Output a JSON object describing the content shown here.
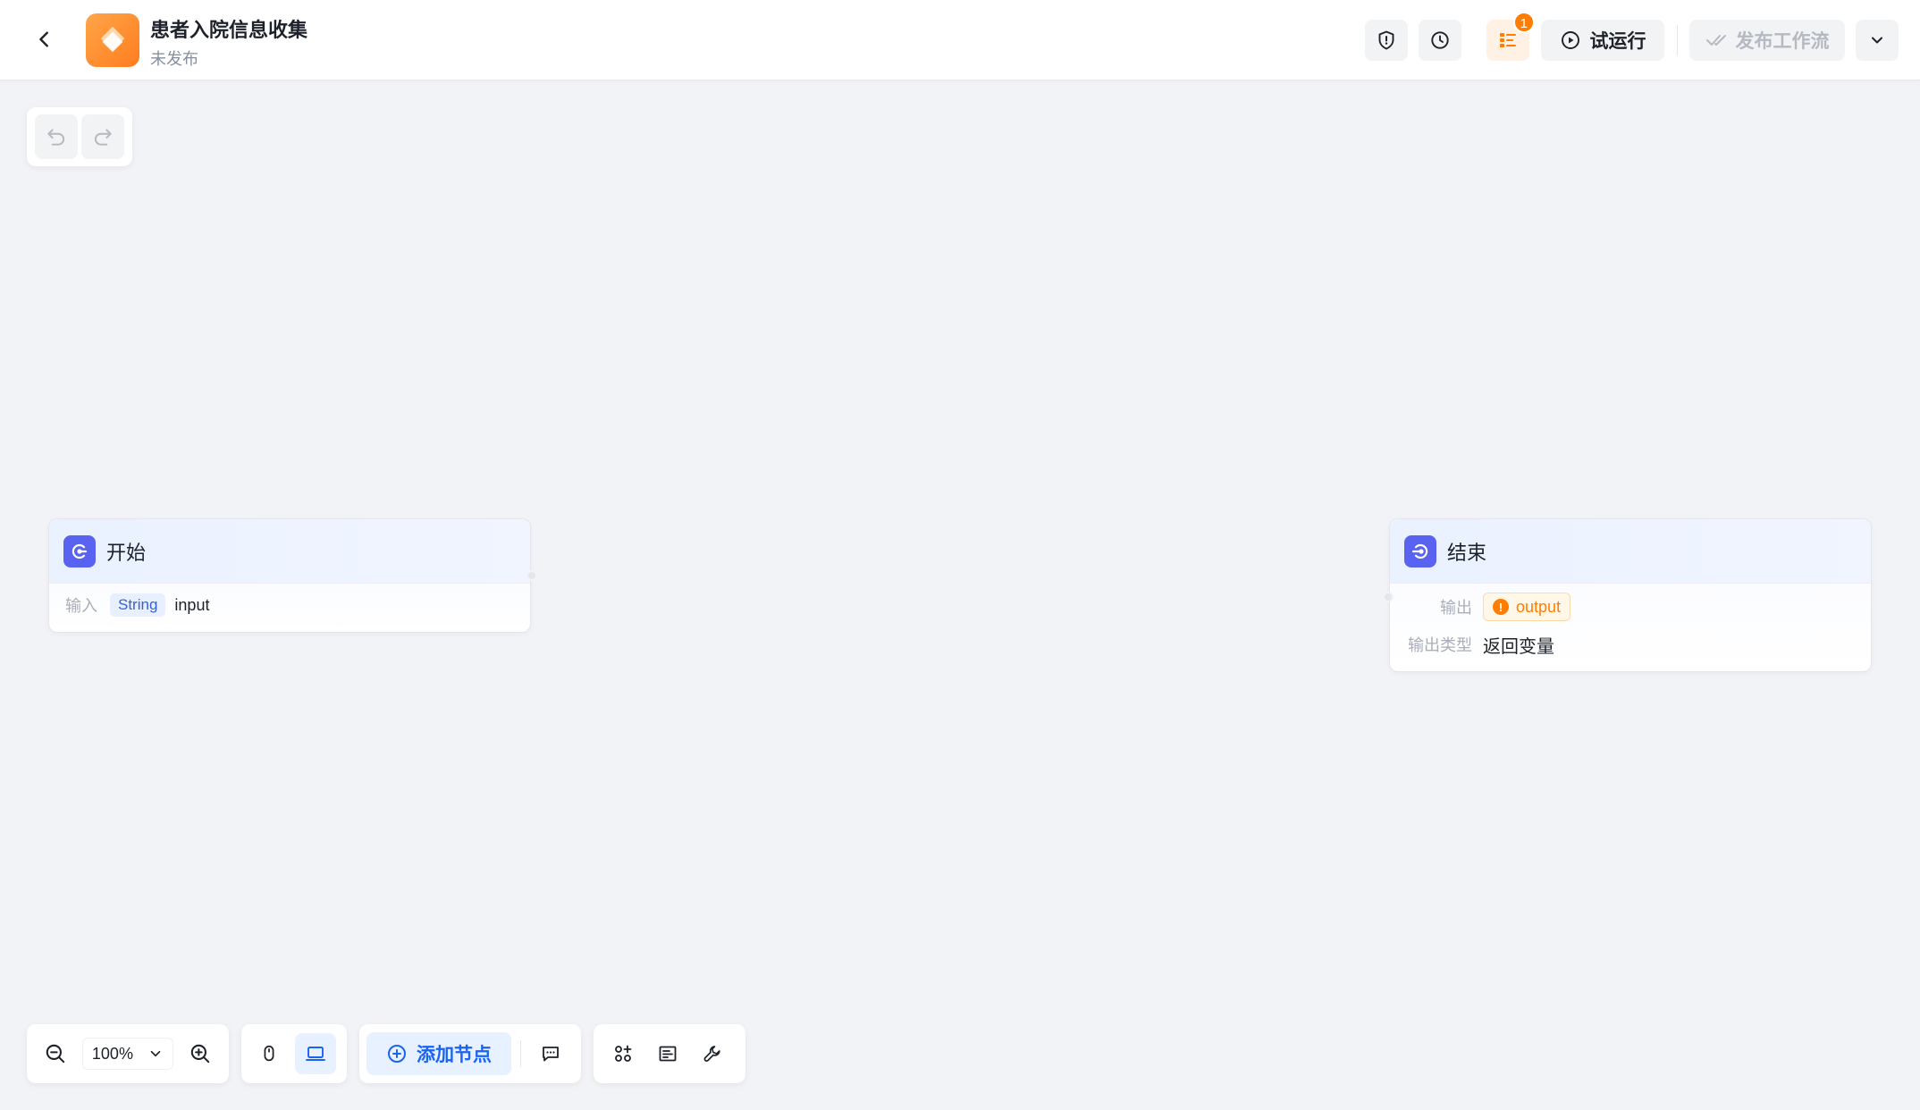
{
  "header": {
    "title": "患者入院信息收集",
    "status": "未发布",
    "issues_badge": "1",
    "test_run_label": "试运行",
    "publish_label": "发布工作流",
    "icons": [
      "back-arrow-icon",
      "app-logo",
      "shield-warning-icon",
      "history-clock-icon",
      "problem-list-icon",
      "play-circle-icon",
      "double-check-icon",
      "chevron-down-icon"
    ]
  },
  "history": {
    "icons": [
      "undo-icon",
      "redo-icon"
    ]
  },
  "nodes": {
    "start": {
      "title": "开始",
      "input_label": "输入",
      "input_type": "String",
      "input_name": "input"
    },
    "end": {
      "title": "结束",
      "output_label": "输出",
      "output_var": "output",
      "output_type_label": "输出类型",
      "output_type_value": "返回变量"
    }
  },
  "toolbar": {
    "zoom_level": "100%",
    "add_node_label": "添加节点",
    "icons": [
      "zoom-out-icon",
      "zoom-in-icon",
      "mouse-mode-icon",
      "touchpad-mode-icon",
      "plus-circle-icon",
      "comment-icon",
      "plugin-icon",
      "layout-icon",
      "tool-icon"
    ]
  },
  "colors": {
    "canvas_bg": "#f2f3f7",
    "brand_orange": "#ff7d00",
    "node_icon": "#5a63f0",
    "primary_blue": "#1b64f2"
  }
}
